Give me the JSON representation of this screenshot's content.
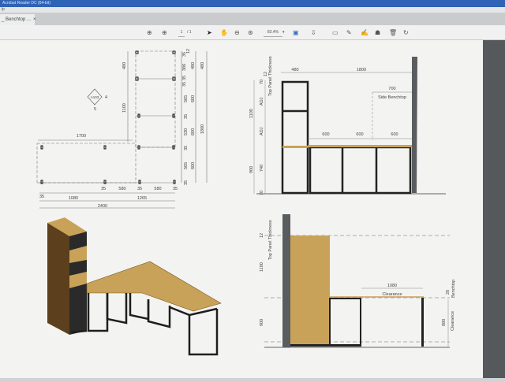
{
  "window": {
    "title": "Acrobat Reader DC (64-bit)",
    "menu": "lp"
  },
  "tab": {
    "label": "_ Benchtop ...",
    "close": "×"
  },
  "toolbar": {
    "page_current": "1",
    "page_total": "/ 1",
    "zoom": "83.4%",
    "icons": [
      "page-up-icon",
      "page-down-icon",
      "select-cursor-icon",
      "hand-icon",
      "zoom-out-icon",
      "zoom-in-icon",
      "page-fit-icon",
      "scroll-mode-icon",
      "comment-icon",
      "pencil-icon",
      "sign-icon",
      "stamp-icon",
      "trash-icon",
      "rotate-icon"
    ]
  },
  "colors": {
    "timber": "#c9a25a",
    "steel": "#1e1e1e",
    "panel": "#5a5d60",
    "titlebar": "#2f63b5"
  },
  "plan": {
    "marker": {
      "label": "A103",
      "left": "4",
      "bottom": "5"
    },
    "d480": "480",
    "d1100": "1100",
    "d1700": "1700",
    "right_chain": [
      "35",
      "386",
      "35",
      "12",
      "35",
      "565",
      "35",
      "530",
      "35",
      "565",
      "35"
    ],
    "right_sub": [
      "480",
      "600",
      "600",
      "600"
    ],
    "right_total_top": "480",
    "right_total": "1800",
    "bottom_chain": [
      "35",
      "580",
      "35",
      "580",
      "35"
    ],
    "left35": "35",
    "d1080": "1080",
    "d1265": "1265",
    "d2400": "2400"
  },
  "elev1": {
    "top_panel": "Top Panel Thickness",
    "d12": "12",
    "d70top": "70",
    "adj1": "ADJ",
    "adj2": "ADJ",
    "d1100": "1100",
    "d900": "900",
    "d740": "740",
    "d70": "70",
    "d480": "480",
    "d1800": "1800",
    "d700": "700",
    "side_benchtop": "Side Benchtop",
    "bays": [
      "600",
      "600",
      "600"
    ]
  },
  "elev2": {
    "top_panel": "Top Panel Thickness",
    "d12": "12",
    "d1100": "1100",
    "d900": "900",
    "d1080": "1080",
    "clearance_top": "Clearance",
    "d20": "20",
    "benchtop": "Benchtop",
    "d880": "880",
    "clearance_side": "Clearance"
  }
}
